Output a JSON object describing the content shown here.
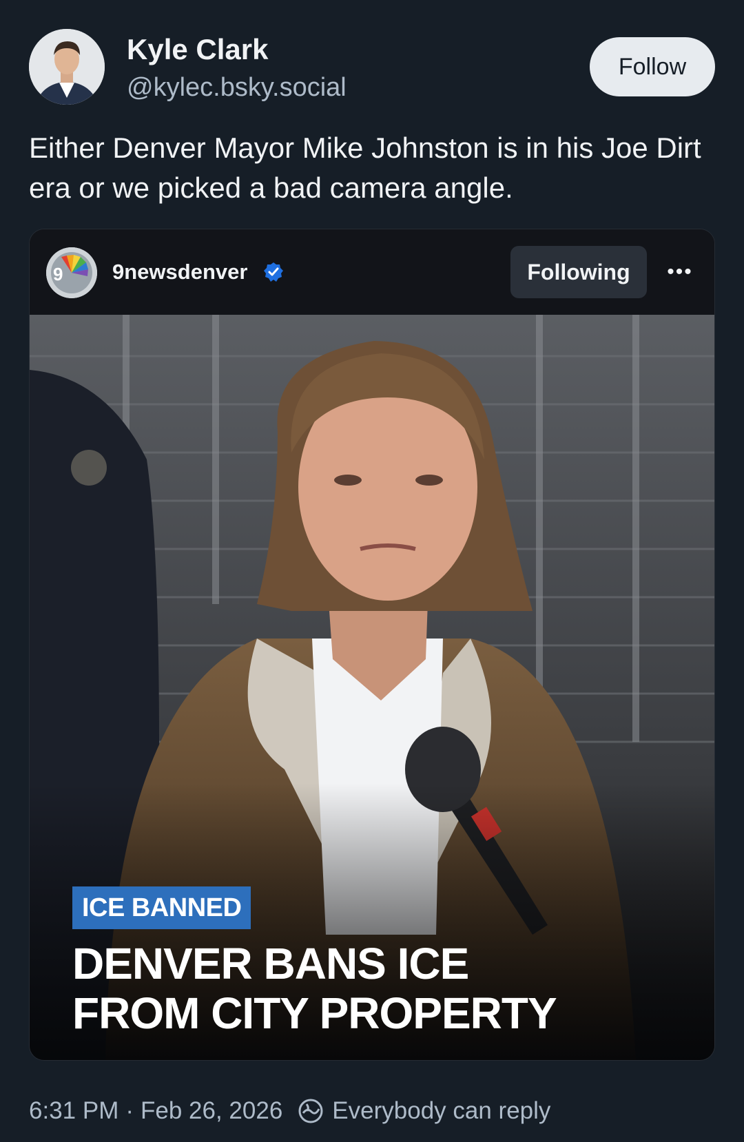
{
  "author": {
    "display_name": "Kyle Clark",
    "handle": "@kylec.bsky.social",
    "follow_label": "Follow"
  },
  "post": {
    "text": "Either Denver Mayor Mike Johnston is in his Joe Dirt era or we picked a bad camera angle."
  },
  "embed": {
    "account": "9newsdenver",
    "following_label": "Following",
    "more_label": "•••",
    "tag": "ICE BANNED",
    "headline_line1": "DENVER BANS ICE",
    "headline_line2": "FROM CITY PROPERTY"
  },
  "footer": {
    "time": "6:31 PM",
    "separator": "·",
    "date": "Feb 26, 2026",
    "reply_setting": "Everybody can reply"
  },
  "colors": {
    "background": "#161e27",
    "follow_button": "#e7ebef",
    "tag_blue": "#2d6fbc",
    "verified_blue": "#1f6fe0"
  }
}
